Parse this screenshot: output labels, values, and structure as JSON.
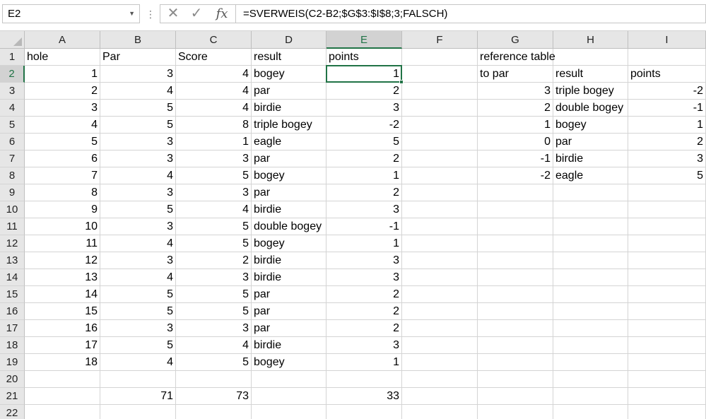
{
  "formula_bar": {
    "name_box": "E2",
    "formula": "=SVERWEIS(C2-B2;$G$3:$I$8;3;FALSCH)",
    "more_icon": "vertical-ellipsis-icon",
    "cancel_icon": "cancel-x-icon",
    "enter_icon": "checkmark-icon",
    "function_icon": "fx-icon"
  },
  "active_cell": "E2",
  "colors": {
    "accent": "#217346",
    "header_bg": "#e6e6e6",
    "gridline": "#d4d4d4"
  },
  "columns": [
    "A",
    "B",
    "C",
    "D",
    "E",
    "F",
    "G",
    "H",
    "I"
  ],
  "rows": [
    "1",
    "2",
    "3",
    "4",
    "5",
    "6",
    "7",
    "8",
    "9",
    "10",
    "11",
    "12",
    "13",
    "14",
    "15",
    "16",
    "17",
    "18",
    "19",
    "20",
    "21",
    "22"
  ],
  "cells": [
    [
      "hole",
      "Par",
      "Score",
      "result",
      "points",
      "",
      "reference table",
      "",
      ""
    ],
    [
      "1",
      "3",
      "4",
      "bogey",
      "1",
      "",
      "to par",
      "result",
      "points"
    ],
    [
      "2",
      "4",
      "4",
      "par",
      "2",
      "",
      "3",
      "triple bogey",
      "-2"
    ],
    [
      "3",
      "5",
      "4",
      "birdie",
      "3",
      "",
      "2",
      "double bogey",
      "-1"
    ],
    [
      "4",
      "5",
      "8",
      "triple bogey",
      "-2",
      "",
      "1",
      "bogey",
      "1"
    ],
    [
      "5",
      "3",
      "1",
      "eagle",
      "5",
      "",
      "0",
      "par",
      "2"
    ],
    [
      "6",
      "3",
      "3",
      "par",
      "2",
      "",
      "-1",
      "birdie",
      "3"
    ],
    [
      "7",
      "4",
      "5",
      "bogey",
      "1",
      "",
      "-2",
      "eagle",
      "5"
    ],
    [
      "8",
      "3",
      "3",
      "par",
      "2",
      "",
      "",
      "",
      ""
    ],
    [
      "9",
      "5",
      "4",
      "birdie",
      "3",
      "",
      "",
      "",
      ""
    ],
    [
      "10",
      "3",
      "5",
      "double bogey",
      "-1",
      "",
      "",
      "",
      ""
    ],
    [
      "11",
      "4",
      "5",
      "bogey",
      "1",
      "",
      "",
      "",
      ""
    ],
    [
      "12",
      "3",
      "2",
      "birdie",
      "3",
      "",
      "",
      "",
      ""
    ],
    [
      "13",
      "4",
      "3",
      "birdie",
      "3",
      "",
      "",
      "",
      ""
    ],
    [
      "14",
      "5",
      "5",
      "par",
      "2",
      "",
      "",
      "",
      ""
    ],
    [
      "15",
      "5",
      "5",
      "par",
      "2",
      "",
      "",
      "",
      ""
    ],
    [
      "16",
      "3",
      "3",
      "par",
      "2",
      "",
      "",
      "",
      ""
    ],
    [
      "17",
      "5",
      "4",
      "birdie",
      "3",
      "",
      "",
      "",
      ""
    ],
    [
      "18",
      "4",
      "5",
      "bogey",
      "1",
      "",
      "",
      "",
      ""
    ],
    [
      "",
      "",
      "",
      "",
      "",
      "",
      "",
      "",
      ""
    ],
    [
      "",
      "71",
      "73",
      "",
      "33",
      "",
      "",
      "",
      ""
    ],
    [
      "",
      "",
      "",
      "",
      "",
      "",
      "",
      "",
      ""
    ]
  ]
}
